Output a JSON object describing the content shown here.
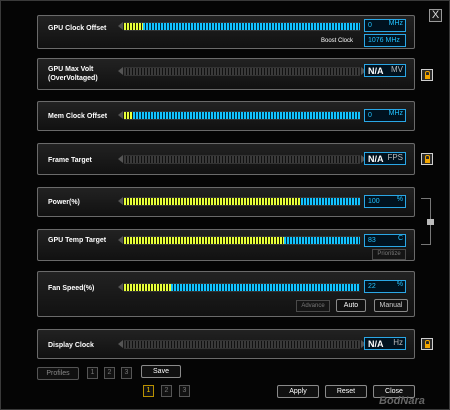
{
  "window": {
    "close_label": "X"
  },
  "rows": {
    "gpu_clock": {
      "label": "GPU Clock Offset",
      "value": "0",
      "unit": "MHz",
      "boost_label": "Boost Clock",
      "boost_value": "1076 MHz",
      "fill_fraction": 0.08
    },
    "gpu_voltage": {
      "label": "GPU Max Volt\n(OverVoltaged)",
      "value": "N/A",
      "unit": "MV",
      "fill_fraction": 0
    },
    "mem_clock": {
      "label": "Mem Clock  Offset",
      "value": "0",
      "unit": "MHz",
      "fill_fraction": 0.04
    },
    "frame_target": {
      "label": "Frame Target",
      "value": "N/A",
      "unit": "FPS",
      "fill_fraction": 0
    },
    "power": {
      "label": "Power(%)",
      "value": "100",
      "unit": "%",
      "fill_fraction": 0.75
    },
    "temp_target": {
      "label": "GPU Temp Target",
      "value": "83",
      "unit": "C",
      "prioritize_label": "Prioritize",
      "fill_fraction": 0.68
    },
    "fan_speed": {
      "label": "Fan Speed(%)",
      "value": "22",
      "unit": "%",
      "fill_fraction": 0.2,
      "advance_label": "Advance",
      "auto_label": "Auto",
      "manual_label": "Manual"
    },
    "display_clock": {
      "label": "Display Clock",
      "value": "N/A",
      "unit": "Hz",
      "fill_fraction": 0
    }
  },
  "footer": {
    "profiles_label": "Profiles",
    "profile_slots": [
      "1",
      "2",
      "3"
    ],
    "save_label": "Save",
    "bank_slots": [
      "1",
      "2",
      "3"
    ],
    "apply_label": "Apply",
    "reset_label": "Reset",
    "close_label": "Close",
    "watermark": "BodNara"
  },
  "colors": {
    "accent": "#21c2ff",
    "highlight": "#e6ff3a",
    "lock": "#f2a600"
  }
}
